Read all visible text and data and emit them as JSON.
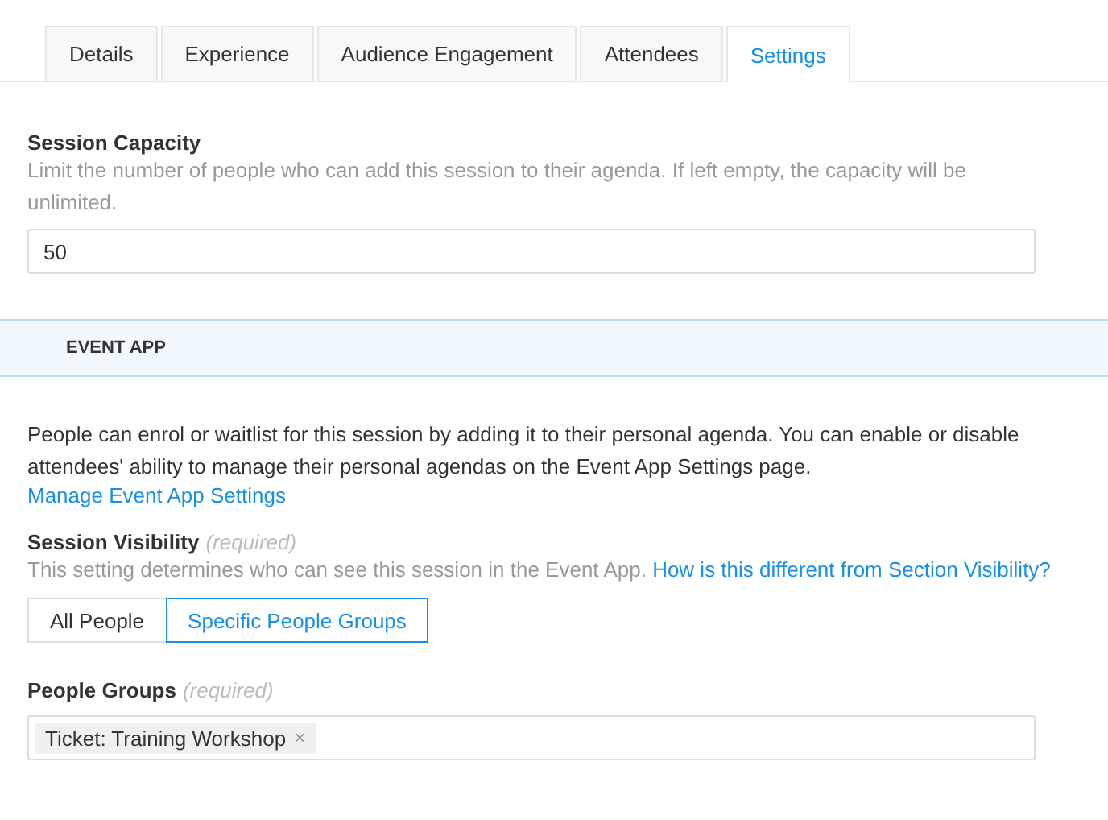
{
  "tabs": [
    {
      "label": "Details",
      "selected": false
    },
    {
      "label": "Experience",
      "selected": false
    },
    {
      "label": "Audience Engagement",
      "selected": false
    },
    {
      "label": "Attendees",
      "selected": false
    },
    {
      "label": "Settings",
      "selected": true
    }
  ],
  "session_capacity": {
    "label": "Session Capacity",
    "help": "Limit the number of people who can add this session to their agenda. If left empty, the capacity will be unlimited.",
    "value": "50"
  },
  "event_app": {
    "heading": "EVENT APP",
    "description": "People can enrol or waitlist for this session by adding it to their personal agenda. You can enable or disable attendees' ability to manage their personal agendas on the Event App Settings page.",
    "link": "Manage Event App Settings",
    "session_visibility": {
      "label": "Session Visibility",
      "required": "(required)",
      "help": "This setting determines who can see this session in the Event App.",
      "help_link": "How is this different from Section Visibility?",
      "options": [
        {
          "label": "All People",
          "selected": false
        },
        {
          "label": "Specific People Groups",
          "selected": true
        }
      ]
    },
    "people_groups": {
      "label": "People Groups",
      "required": "(required)",
      "tags": [
        {
          "label": "Ticket: Training Workshop",
          "remove": "×"
        }
      ]
    }
  }
}
